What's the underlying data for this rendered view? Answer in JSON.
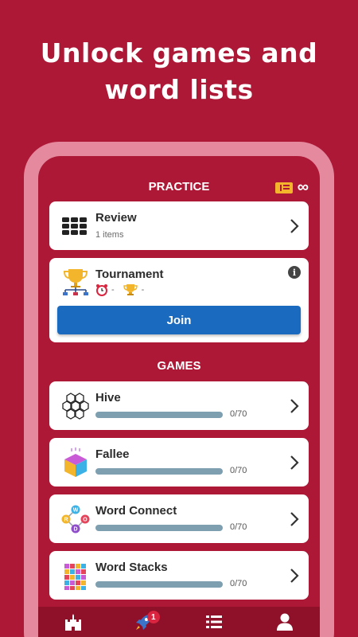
{
  "headline": {
    "line1": "Unlock games and",
    "line2": "word lists"
  },
  "practice": {
    "title": "PRACTICE",
    "tickets": "∞",
    "review": {
      "title": "Review",
      "subtitle": "1 items"
    },
    "tournament": {
      "title": "Tournament",
      "timer_value": "-",
      "trophy_value": "-",
      "join_label": "Join",
      "info": "i"
    }
  },
  "games": {
    "title": "GAMES",
    "items": [
      {
        "title": "Hive",
        "progress_text": "0/70",
        "progress": 0
      },
      {
        "title": "Fallee",
        "progress_text": "0/70",
        "progress": 0
      },
      {
        "title": "Word Connect",
        "progress_text": "0/70",
        "progress": 0,
        "letters": [
          "W",
          "R",
          "O",
          "D"
        ]
      },
      {
        "title": "Word Stacks",
        "progress_text": "0/70",
        "progress": 0
      }
    ]
  },
  "nav": {
    "badge": "1"
  },
  "colors": {
    "background": "#ad1837",
    "accent": "#1a6abf",
    "frame": "#e58a9e"
  }
}
